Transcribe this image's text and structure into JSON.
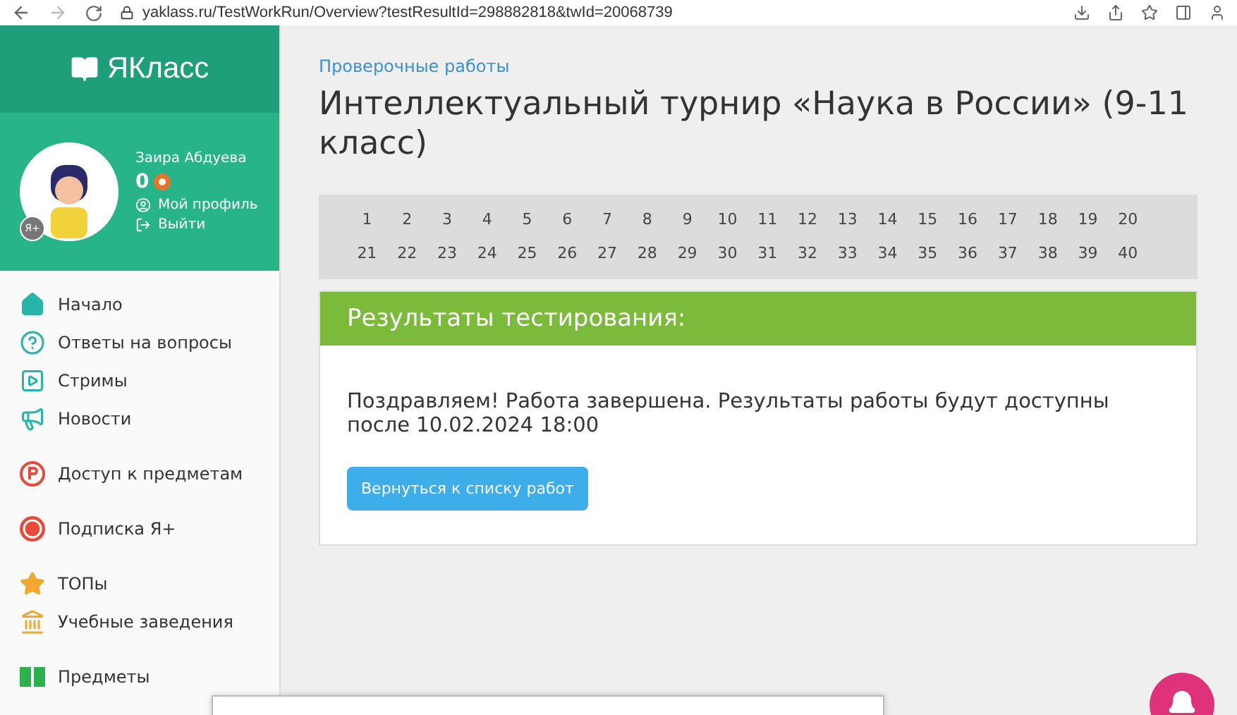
{
  "browser": {
    "url": "yaklass.ru/TestWorkRun/Overview?testResultId=298882818&twId=20068739"
  },
  "sidebar": {
    "logo": "ЯКласс",
    "user": {
      "name": "Заира Абдуева",
      "points": "0",
      "badge": "Я+",
      "links": [
        {
          "kind": "profile",
          "label": "Мой профиль"
        },
        {
          "kind": "logout",
          "label": "Выйти"
        }
      ]
    },
    "groups": [
      [
        {
          "kind": "home",
          "label": "Начало"
        },
        {
          "kind": "question",
          "label": "Ответы на вопросы"
        },
        {
          "kind": "stream",
          "label": "Стримы"
        },
        {
          "kind": "news",
          "label": "Новости"
        }
      ],
      [
        {
          "kind": "access",
          "label": "Доступ к предметам"
        }
      ],
      [
        {
          "kind": "subscription",
          "label": "Подписка Я+"
        }
      ],
      [
        {
          "kind": "top",
          "label": "ТОПы"
        },
        {
          "kind": "school",
          "label": "Учебные заведения"
        }
      ],
      [
        {
          "kind": "subjects",
          "label": "Предметы"
        }
      ]
    ]
  },
  "breadcrumb": "Проверочные работы",
  "title": "Интеллектуальный турнир «Наука в России» (9-11 класс)",
  "questions": [
    "1",
    "2",
    "3",
    "4",
    "5",
    "6",
    "7",
    "8",
    "9",
    "10",
    "11",
    "12",
    "13",
    "14",
    "15",
    "16",
    "17",
    "18",
    "19",
    "20",
    "21",
    "22",
    "23",
    "24",
    "25",
    "26",
    "27",
    "28",
    "29",
    "30",
    "31",
    "32",
    "33",
    "34",
    "35",
    "36",
    "37",
    "38",
    "39",
    "40"
  ],
  "results": {
    "heading": "Результаты тестирования:",
    "message": "Поздравляем! Работа завершена. Результаты работы будут доступны после 10.02.2024 18:00",
    "button": "Вернуться к списку работ"
  }
}
